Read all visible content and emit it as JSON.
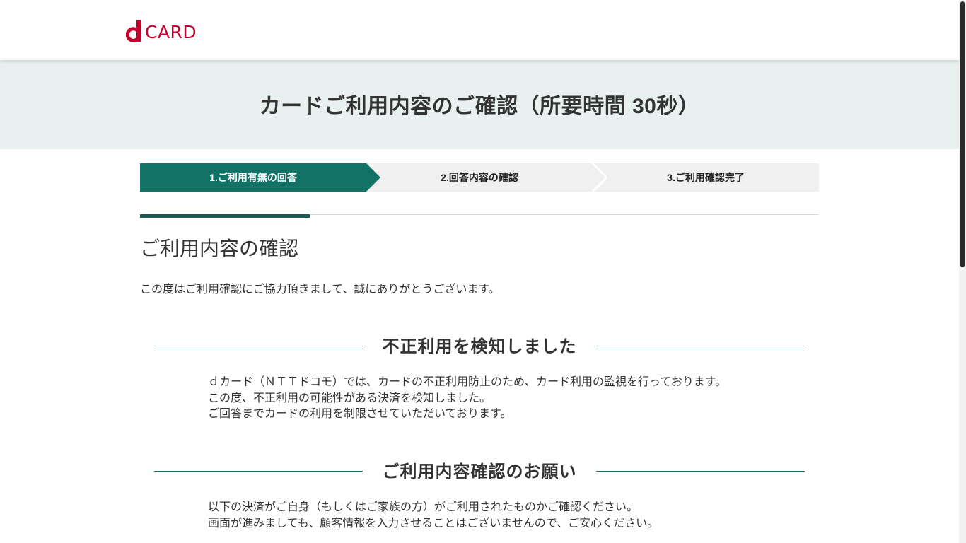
{
  "header": {
    "logo_text": "CARD",
    "logo_mark": "d",
    "brand_color": "#c4002e"
  },
  "banner": {
    "title": "カードご利用内容のご確認（所要時間 30秒）",
    "background": "#e8f1f0"
  },
  "steps": {
    "active_color": "#127266",
    "items": [
      {
        "label": "1.ご利用有無の回答",
        "active": true
      },
      {
        "label": "2.回答内容の確認",
        "active": false
      },
      {
        "label": "3.ご利用確認完了",
        "active": false
      }
    ]
  },
  "section": {
    "title": "ご利用内容の確認",
    "intro": "この度はご利用確認にご協力頂きまして、誠にありがとうございます。"
  },
  "fraud_notice": {
    "heading": "不正利用を検知しました",
    "lines": [
      "ｄカード（ＮＴＴドコモ）では、カードの不正利用防止のため、カード利用の監視を行っております。",
      "この度、不正利用の可能性がある決済を検知しました。",
      "ご回答までカードの利用を制限させていただいております。"
    ]
  },
  "confirm_request": {
    "heading": "ご利用内容確認のお願い",
    "lines": [
      "以下の決済がご自身（もしくはご家族の方）がご利用されたものかご確認ください。",
      "画面が進みましても、顧客情報を入力させることはございませんので、ご安心ください。"
    ]
  }
}
